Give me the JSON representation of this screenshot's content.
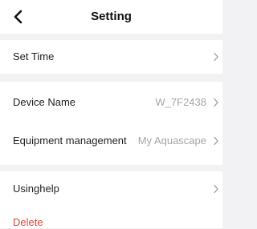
{
  "header": {
    "title": "Setting",
    "back_icon": "chevron-left-icon"
  },
  "rows": {
    "set_time": {
      "label": "Set Time",
      "chevron_icon": "chevron-right-icon"
    },
    "device_name": {
      "label": "Device Name",
      "value": "W_7F2438",
      "chevron_icon": "chevron-right-icon"
    },
    "equipment_management": {
      "label": "Equipment management",
      "value": "My Aquascape",
      "chevron_icon": "chevron-right-icon"
    },
    "using_help": {
      "label": "Usinghelp",
      "chevron_icon": "chevron-right-icon"
    },
    "delete": {
      "label": "Delete",
      "color": "#e0443a"
    }
  },
  "colors": {
    "background": "#f2f2f4",
    "panel": "#ffffff",
    "secondary_text": "#a5a5a5",
    "danger": "#e0443a"
  }
}
